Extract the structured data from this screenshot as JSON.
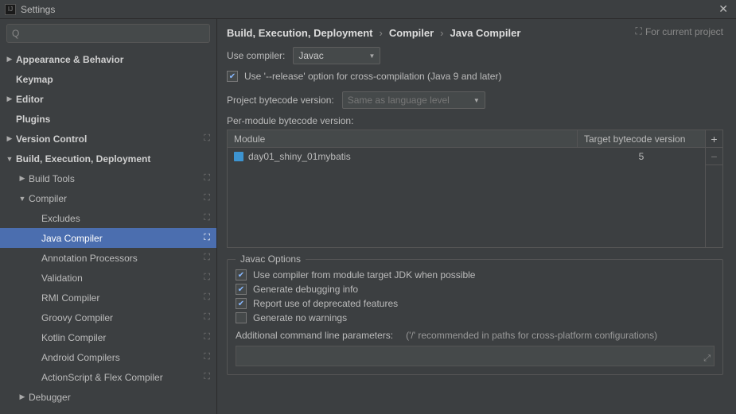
{
  "window": {
    "title": "Settings"
  },
  "search": {
    "placeholder": ""
  },
  "sidebar": {
    "items": [
      {
        "label": "Appearance & Behavior",
        "level": 0,
        "arrow": "▶",
        "bold": true
      },
      {
        "label": "Keymap",
        "level": 0,
        "arrow": "",
        "bold": true
      },
      {
        "label": "Editor",
        "level": 0,
        "arrow": "▶",
        "bold": true
      },
      {
        "label": "Plugins",
        "level": 0,
        "arrow": "",
        "bold": true
      },
      {
        "label": "Version Control",
        "level": 0,
        "arrow": "▶",
        "bold": true,
        "badge": "⛶"
      },
      {
        "label": "Build, Execution, Deployment",
        "level": 0,
        "arrow": "▼",
        "bold": true
      },
      {
        "label": "Build Tools",
        "level": 1,
        "arrow": "▶",
        "badge": "⛶"
      },
      {
        "label": "Compiler",
        "level": 1,
        "arrow": "▼",
        "badge": "⛶"
      },
      {
        "label": "Excludes",
        "level": 2,
        "arrow": "",
        "badge": "⛶"
      },
      {
        "label": "Java Compiler",
        "level": 2,
        "arrow": "",
        "badge": "⛶",
        "selected": true
      },
      {
        "label": "Annotation Processors",
        "level": 2,
        "arrow": "",
        "badge": "⛶"
      },
      {
        "label": "Validation",
        "level": 2,
        "arrow": "",
        "badge": "⛶"
      },
      {
        "label": "RMI Compiler",
        "level": 2,
        "arrow": "",
        "badge": "⛶"
      },
      {
        "label": "Groovy Compiler",
        "level": 2,
        "arrow": "",
        "badge": "⛶"
      },
      {
        "label": "Kotlin Compiler",
        "level": 2,
        "arrow": "",
        "badge": "⛶"
      },
      {
        "label": "Android Compilers",
        "level": 2,
        "arrow": "",
        "badge": "⛶"
      },
      {
        "label": "ActionScript & Flex Compiler",
        "level": 2,
        "arrow": "",
        "badge": "⛶"
      },
      {
        "label": "Debugger",
        "level": 1,
        "arrow": "▶"
      }
    ]
  },
  "breadcrumb": {
    "a": "Build, Execution, Deployment",
    "b": "Compiler",
    "c": "Java Compiler"
  },
  "for_project": "For current project",
  "form": {
    "use_compiler_label": "Use compiler:",
    "use_compiler_value": "Javac",
    "release_option": "Use '--release' option for cross-compilation (Java 9 and later)",
    "project_bytecode_label": "Project bytecode version:",
    "project_bytecode_value": "Same as language level",
    "per_module_label": "Per-module bytecode version:"
  },
  "table": {
    "col_module": "Module",
    "col_target": "Target bytecode version",
    "rows": [
      {
        "module": "day01_shiny_01mybatis",
        "target": "5"
      }
    ]
  },
  "javac": {
    "group_title": "Javac Options",
    "opt1": "Use compiler from module target JDK when possible",
    "opt2": "Generate debugging info",
    "opt3": "Report use of deprecated features",
    "opt4": "Generate no warnings",
    "add_label": "Additional command line parameters:",
    "add_hint": "('/' recommended in paths for cross-platform configurations)"
  }
}
